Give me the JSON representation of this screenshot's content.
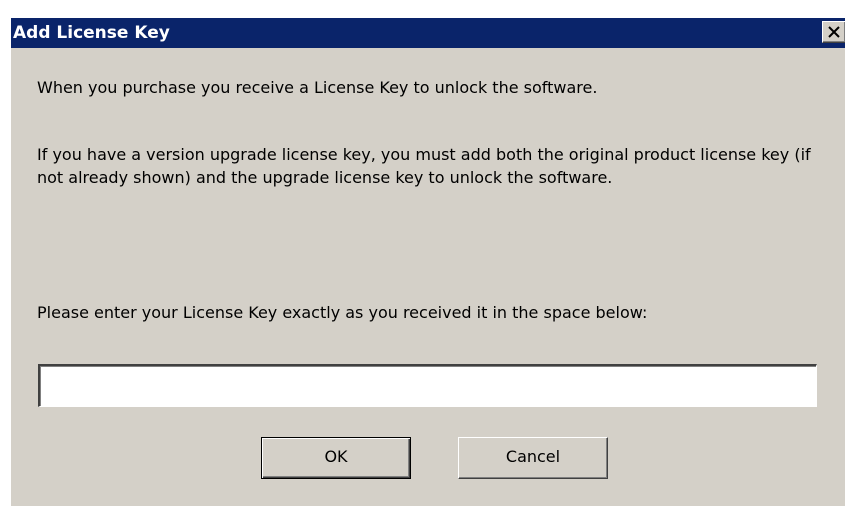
{
  "window": {
    "title": "Add License Key",
    "close_icon": "close-x-icon",
    "titlebar_color": "#0a246a",
    "background_color": "#d4d0c8"
  },
  "body": {
    "paragraph1": "When you purchase you receive a License Key to unlock the software.",
    "paragraph2": "If you have a version upgrade license key, you must add both the original product license key (if not already shown) and the upgrade license key to unlock the software.",
    "prompt": "Please enter your License Key exactly as you received it in the space below:"
  },
  "license_input": {
    "value": ""
  },
  "buttons": {
    "ok": "OK",
    "cancel": "Cancel"
  }
}
